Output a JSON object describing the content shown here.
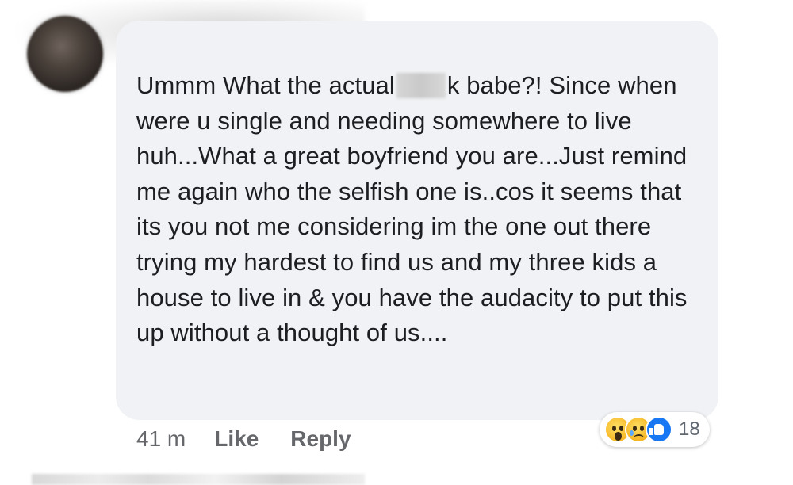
{
  "comment": {
    "text_before_redaction": "Ummm What the actual",
    "text_after_redaction": "k babe?! Since when were u single and needing somewhere to live huh...What a great boyfriend you are...Just remind me again who the selfish one is..cos it seems that its you not me considering im the one out there trying my  hardest to find us and my three kids a house to live in & you have the audacity to put this up without a thought of us...."
  },
  "reactions": {
    "icons": [
      "wow-icon",
      "sad-icon",
      "like-icon"
    ],
    "count": "18"
  },
  "actions": {
    "timestamp": "41 m",
    "like_label": "Like",
    "reply_label": "Reply"
  },
  "colors": {
    "bubble": "#f0f2f5",
    "text": "#1c1e21",
    "meta": "#65676b",
    "like_blue": "#1877f2"
  }
}
